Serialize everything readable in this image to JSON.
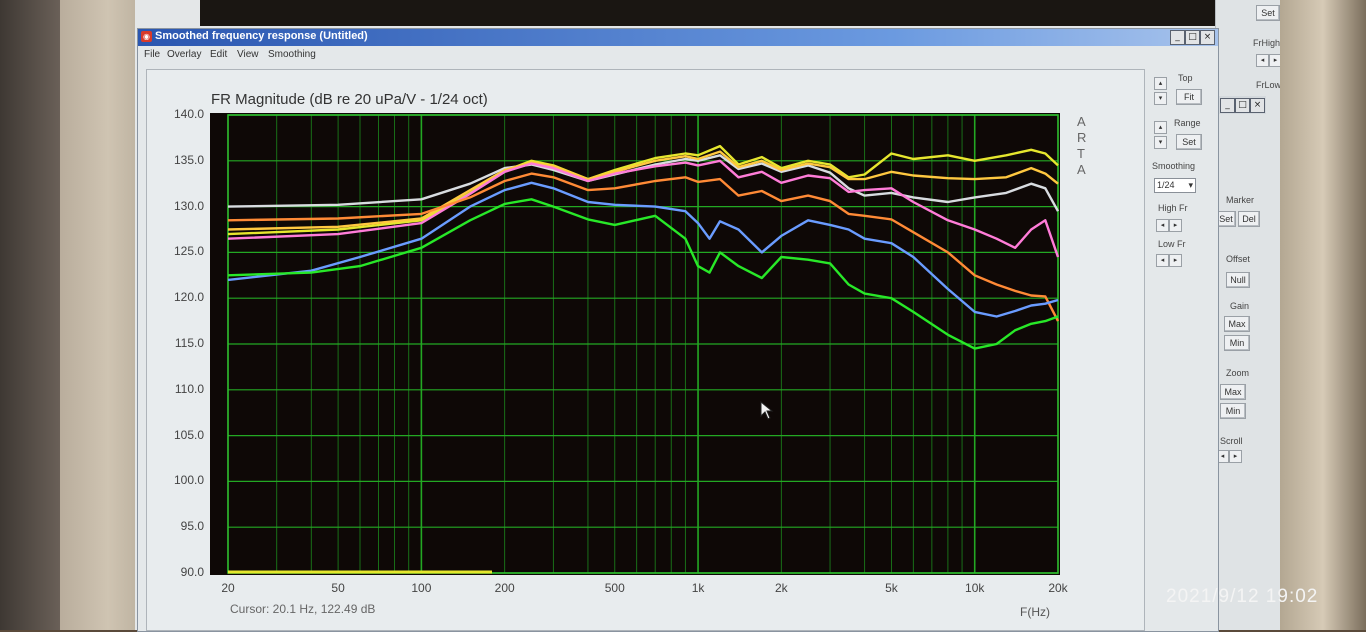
{
  "window": {
    "title": "Smoothed frequency response (Untitled)",
    "menu": [
      "File",
      "Overlay",
      "Edit",
      "View",
      "Smoothing"
    ]
  },
  "side_panel": {
    "top_label": "Top",
    "fit_button": "Fit",
    "range_label": "Range",
    "set_button": "Set",
    "smoothing_label": "Smoothing",
    "smoothing_value": "1/24",
    "high_fr_label": "High Fr",
    "low_fr_label": "Low Fr"
  },
  "back_panel": {
    "set_button": "Set",
    "frhigh_label": "FrHigh",
    "frlow_label": "FrLow",
    "marker_label": "Marker",
    "marker_set": "Set",
    "marker_del": "Del",
    "offset_label": "Offset",
    "null_button": "Null",
    "gain_label": "Gain",
    "gain_max": "Max",
    "gain_min": "Min",
    "zoom_label": "Zoom",
    "zoom_max": "Max",
    "zoom_min": "Min",
    "scroll_label": "Scroll"
  },
  "cursor_readout": "Cursor: 20.1 Hz, 122.49 dB",
  "arta_mark": [
    "A",
    "R",
    "T",
    "A"
  ],
  "timestamp": "2021/9/12  19:02",
  "chart_data": {
    "type": "line",
    "title": "FR Magnitude (dB re 20 uPa/V - 1/24 oct)",
    "xlabel": "F(Hz)",
    "x_scale": "log",
    "xlim": [
      20,
      20000
    ],
    "ylim": [
      90,
      140
    ],
    "y_ticks": [
      "140.0",
      "135.0",
      "130.0",
      "125.0",
      "120.0",
      "115.0",
      "110.0",
      "105.0",
      "100.0",
      "95.0",
      "90.0"
    ],
    "x_ticks": [
      {
        "v": 20,
        "label": "20"
      },
      {
        "v": 50,
        "label": "50"
      },
      {
        "v": 100,
        "label": "100"
      },
      {
        "v": 200,
        "label": "200"
      },
      {
        "v": 500,
        "label": "500"
      },
      {
        "v": 1000,
        "label": "1k"
      },
      {
        "v": 2000,
        "label": "2k"
      },
      {
        "v": 5000,
        "label": "5k"
      },
      {
        "v": 10000,
        "label": "10k"
      },
      {
        "v": 20000,
        "label": "20k"
      }
    ],
    "grid": true,
    "series": [
      {
        "color": "#d8dce0",
        "points": [
          [
            20,
            130
          ],
          [
            50,
            130.2
          ],
          [
            100,
            130.8
          ],
          [
            150,
            132.5
          ],
          [
            200,
            134.2
          ],
          [
            250,
            134.6
          ],
          [
            300,
            134
          ],
          [
            400,
            132.8
          ],
          [
            500,
            133.5
          ],
          [
            700,
            134.6
          ],
          [
            900,
            135.2
          ],
          [
            1000,
            135
          ],
          [
            1200,
            135.6
          ],
          [
            1400,
            134.1
          ],
          [
            1700,
            134.7
          ],
          [
            2000,
            133.8
          ],
          [
            2500,
            134.5
          ],
          [
            3000,
            133.7
          ],
          [
            3500,
            132
          ],
          [
            4000,
            131.2
          ],
          [
            5000,
            131.5
          ],
          [
            6000,
            131
          ],
          [
            8000,
            130.5
          ],
          [
            10000,
            131
          ],
          [
            13000,
            131.5
          ],
          [
            16000,
            132.5
          ],
          [
            18000,
            132
          ],
          [
            20000,
            129.5
          ]
        ]
      },
      {
        "color": "#e6e62e",
        "points": [
          [
            20,
            127
          ],
          [
            50,
            127.5
          ],
          [
            100,
            128.5
          ],
          [
            150,
            131.5
          ],
          [
            200,
            133.9
          ],
          [
            250,
            135
          ],
          [
            300,
            134.5
          ],
          [
            400,
            133
          ],
          [
            500,
            134
          ],
          [
            700,
            135.3
          ],
          [
            900,
            135.8
          ],
          [
            1000,
            135.6
          ],
          [
            1200,
            136.6
          ],
          [
            1400,
            134.6
          ],
          [
            1700,
            135.4
          ],
          [
            2000,
            134.2
          ],
          [
            2500,
            135
          ],
          [
            3000,
            134.6
          ],
          [
            3500,
            133.2
          ],
          [
            4000,
            133.5
          ],
          [
            5000,
            135.8
          ],
          [
            6000,
            135.2
          ],
          [
            8000,
            135.6
          ],
          [
            10000,
            135
          ],
          [
            13000,
            135.6
          ],
          [
            16000,
            136.2
          ],
          [
            18000,
            135.8
          ],
          [
            20000,
            134.5
          ]
        ]
      },
      {
        "color": "#ffc840",
        "points": [
          [
            20,
            127.5
          ],
          [
            50,
            127.8
          ],
          [
            100,
            128.7
          ],
          [
            150,
            131.8
          ],
          [
            200,
            134
          ],
          [
            250,
            134.8
          ],
          [
            300,
            134.4
          ],
          [
            400,
            133
          ],
          [
            500,
            133.8
          ],
          [
            700,
            135
          ],
          [
            900,
            135.5
          ],
          [
            1000,
            135.2
          ],
          [
            1200,
            136
          ],
          [
            1400,
            134.3
          ],
          [
            1700,
            135
          ],
          [
            2000,
            134
          ],
          [
            2500,
            134.7
          ],
          [
            3000,
            134.3
          ],
          [
            3500,
            133
          ],
          [
            4000,
            133
          ],
          [
            5000,
            133.8
          ],
          [
            6000,
            133.4
          ],
          [
            8000,
            133.1
          ],
          [
            10000,
            133
          ],
          [
            13000,
            133.2
          ],
          [
            16000,
            134.2
          ],
          [
            18000,
            133.6
          ],
          [
            20000,
            132.5
          ]
        ]
      },
      {
        "color": "#ff7cd8",
        "points": [
          [
            20,
            126.5
          ],
          [
            50,
            127
          ],
          [
            100,
            128.2
          ],
          [
            150,
            131.4
          ],
          [
            200,
            133.8
          ],
          [
            250,
            134.7
          ],
          [
            300,
            134.2
          ],
          [
            400,
            132.8
          ],
          [
            500,
            133.6
          ],
          [
            700,
            134.4
          ],
          [
            900,
            134.8
          ],
          [
            1000,
            134.5
          ],
          [
            1200,
            135
          ],
          [
            1400,
            133.2
          ],
          [
            1700,
            133.8
          ],
          [
            2000,
            132.6
          ],
          [
            2500,
            133.4
          ],
          [
            3000,
            133.1
          ],
          [
            3500,
            131.6
          ],
          [
            4000,
            131.8
          ],
          [
            5000,
            132
          ],
          [
            6000,
            130.5
          ],
          [
            8000,
            128.5
          ],
          [
            10000,
            127.5
          ],
          [
            12000,
            126.5
          ],
          [
            14000,
            125.5
          ],
          [
            16000,
            127.5
          ],
          [
            18000,
            128.5
          ],
          [
            20000,
            124.5
          ]
        ]
      },
      {
        "color": "#ff8a36",
        "points": [
          [
            20,
            128.5
          ],
          [
            50,
            128.7
          ],
          [
            100,
            129.2
          ],
          [
            150,
            131
          ],
          [
            200,
            132.8
          ],
          [
            250,
            133.6
          ],
          [
            300,
            133.2
          ],
          [
            400,
            131.8
          ],
          [
            500,
            132
          ],
          [
            700,
            132.8
          ],
          [
            900,
            133.2
          ],
          [
            1000,
            132.7
          ],
          [
            1200,
            133
          ],
          [
            1400,
            131.2
          ],
          [
            1700,
            131.7
          ],
          [
            2000,
            130.6
          ],
          [
            2500,
            131.2
          ],
          [
            3000,
            130.6
          ],
          [
            3500,
            129.2
          ],
          [
            4000,
            129
          ],
          [
            5000,
            128.6
          ],
          [
            6000,
            127.2
          ],
          [
            8000,
            125
          ],
          [
            10000,
            122.5
          ],
          [
            12000,
            121.5
          ],
          [
            14000,
            120.8
          ],
          [
            16000,
            120.3
          ],
          [
            18000,
            120.2
          ],
          [
            20000,
            117.5
          ]
        ]
      },
      {
        "color": "#6a9cff",
        "points": [
          [
            20,
            122
          ],
          [
            40,
            123
          ],
          [
            60,
            124.5
          ],
          [
            100,
            126.5
          ],
          [
            150,
            130
          ],
          [
            200,
            131.8
          ],
          [
            250,
            132.6
          ],
          [
            300,
            132
          ],
          [
            400,
            130.5
          ],
          [
            500,
            130.2
          ],
          [
            700,
            130
          ],
          [
            900,
            129.5
          ],
          [
            1000,
            128.2
          ],
          [
            1100,
            126.5
          ],
          [
            1200,
            128.4
          ],
          [
            1400,
            127.5
          ],
          [
            1700,
            125
          ],
          [
            2000,
            126.8
          ],
          [
            2500,
            128.5
          ],
          [
            3000,
            128
          ],
          [
            3500,
            127.5
          ],
          [
            4000,
            126.5
          ],
          [
            5000,
            126
          ],
          [
            6000,
            124.5
          ],
          [
            8000,
            121
          ],
          [
            10000,
            118.5
          ],
          [
            12000,
            118
          ],
          [
            14000,
            118.6
          ],
          [
            16000,
            119.2
          ],
          [
            18000,
            119.4
          ],
          [
            20000,
            119.8
          ]
        ]
      },
      {
        "color": "#28e828",
        "points": [
          [
            20,
            122.5
          ],
          [
            40,
            122.8
          ],
          [
            60,
            123.5
          ],
          [
            100,
            125.5
          ],
          [
            150,
            128.5
          ],
          [
            200,
            130.3
          ],
          [
            250,
            130.8
          ],
          [
            300,
            130
          ],
          [
            400,
            128.6
          ],
          [
            500,
            128
          ],
          [
            700,
            129
          ],
          [
            900,
            126.5
          ],
          [
            1000,
            123.5
          ],
          [
            1100,
            122.8
          ],
          [
            1200,
            125
          ],
          [
            1400,
            123.5
          ],
          [
            1700,
            122.2
          ],
          [
            2000,
            124.5
          ],
          [
            2500,
            124.2
          ],
          [
            3000,
            123.8
          ],
          [
            3500,
            121.5
          ],
          [
            4000,
            120.5
          ],
          [
            5000,
            120
          ],
          [
            6000,
            118.5
          ],
          [
            8000,
            116
          ],
          [
            10000,
            114.5
          ],
          [
            12000,
            115
          ],
          [
            14000,
            116.5
          ],
          [
            16000,
            117.2
          ],
          [
            18000,
            117.5
          ],
          [
            20000,
            118
          ]
        ]
      }
    ]
  }
}
